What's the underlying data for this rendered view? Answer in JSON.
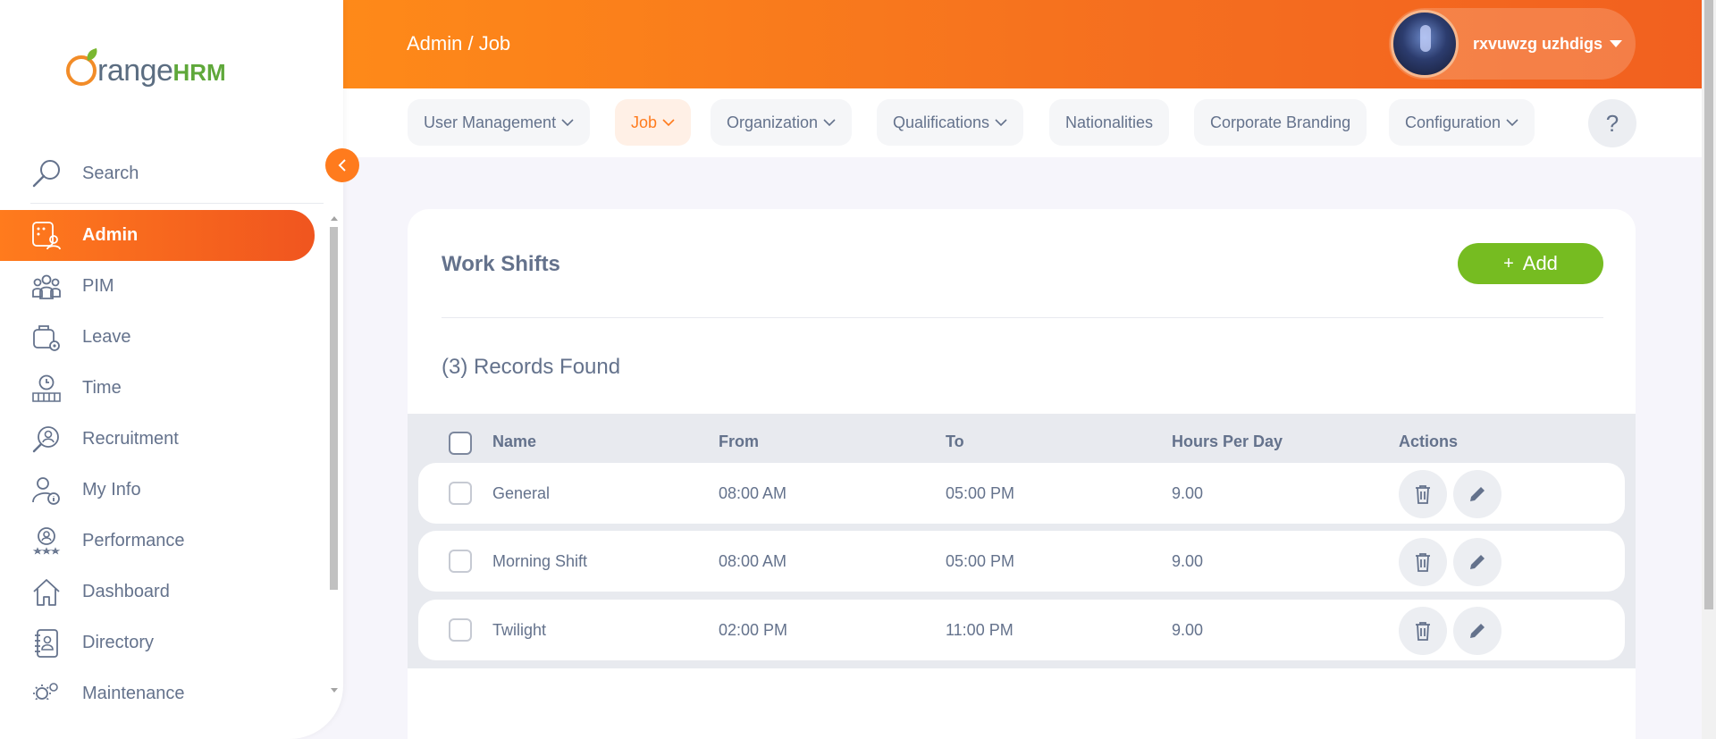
{
  "logo": {
    "prefix": "range",
    "suffix": "HRM"
  },
  "search": {
    "label": "Search"
  },
  "sidebar": {
    "items": [
      {
        "label": "Admin",
        "icon": "admin-icon",
        "active": true
      },
      {
        "label": "PIM",
        "icon": "pim-icon"
      },
      {
        "label": "Leave",
        "icon": "leave-icon"
      },
      {
        "label": "Time",
        "icon": "time-icon"
      },
      {
        "label": "Recruitment",
        "icon": "recruitment-icon"
      },
      {
        "label": "My Info",
        "icon": "my-info-icon"
      },
      {
        "label": "Performance",
        "icon": "performance-icon"
      },
      {
        "label": "Dashboard",
        "icon": "dashboard-icon"
      },
      {
        "label": "Directory",
        "icon": "directory-icon"
      },
      {
        "label": "Maintenance",
        "icon": "maintenance-icon"
      }
    ]
  },
  "header": {
    "breadcrumb": "Admin / Job",
    "user_name": "rxvuwzg uzhdigs"
  },
  "subnav": {
    "tabs": [
      {
        "label": "User Management",
        "dropdown": true
      },
      {
        "label": "Job",
        "dropdown": true,
        "active": true
      },
      {
        "label": "Organization",
        "dropdown": true
      },
      {
        "label": "Qualifications",
        "dropdown": true
      },
      {
        "label": "Nationalities",
        "dropdown": false
      },
      {
        "label": "Corporate Branding",
        "dropdown": false
      },
      {
        "label": "Configuration",
        "dropdown": true
      }
    ],
    "help": "?"
  },
  "main": {
    "title": "Work Shifts",
    "add_label": "Add",
    "add_plus": "+",
    "records": "(3) Records Found",
    "columns": [
      "Name",
      "From",
      "To",
      "Hours Per Day",
      "Actions"
    ],
    "rows": [
      {
        "name": "General",
        "from": "08:00 AM",
        "to": "05:00 PM",
        "hours": "9.00"
      },
      {
        "name": "Morning Shift",
        "from": "08:00 AM",
        "to": "05:00 PM",
        "hours": "9.00"
      },
      {
        "name": "Twilight",
        "from": "02:00 PM",
        "to": "11:00 PM",
        "hours": "9.00"
      }
    ]
  },
  "colors": {
    "accent": "#ff7b1d",
    "add_button": "#76bc21",
    "text": "#64728c"
  }
}
